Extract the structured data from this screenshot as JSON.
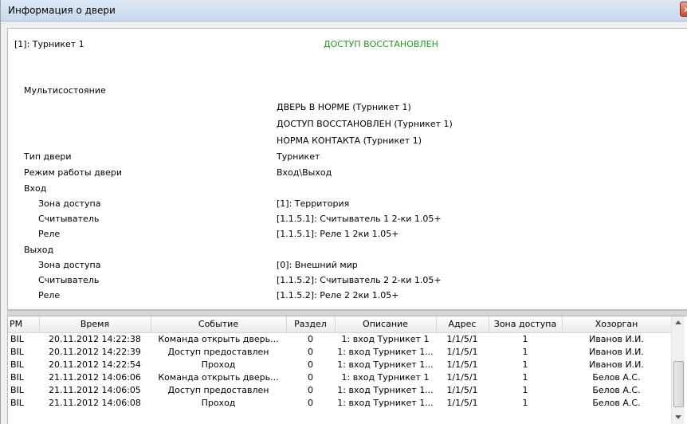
{
  "window": {
    "title": "Информация о двери",
    "close_glyph": "x"
  },
  "door": {
    "name": "[1]: Турникет 1",
    "status": "ДОСТУП ВОССТАНОВЛЕН",
    "status_color": "#1f9a1f"
  },
  "properties": {
    "multistate_label": "Мультисостояние",
    "multistate_values": [
      "ДВЕРЬ В НОРМЕ (Турникет 1)",
      "ДОСТУП ВОССТАНОВЛЕН (Турникет 1)",
      "НОРМА КОНТАКТА (Турникет 1)"
    ],
    "door_type_label": "Тип двери",
    "door_type_value": "Турникет",
    "mode_label": "Режим работы двери",
    "mode_value": "Вход\\Выход",
    "entry_label": "Вход",
    "entry_zone_label": "Зона доступа",
    "entry_zone_value": "[1]: Территория",
    "entry_reader_label": "Считыватель",
    "entry_reader_value": "[1.1.5.1]: Считыватель 1 2-ки 1.05+",
    "entry_relay_label": "Реле",
    "entry_relay_value": "[1.1.5.1]: Реле 1 2ки 1.05+",
    "exit_label": "Выход",
    "exit_zone_label": "Зона доступа",
    "exit_zone_value": "[0]: Внешний мир",
    "exit_reader_label": "Считыватель",
    "exit_reader_value": "[1.1.5.2]: Считыватель 2 2-ки 1.05+",
    "exit_relay_label": "Реле",
    "exit_relay_value": "[1.1.5.2]: Реле 2 2ки 1.05+"
  },
  "events": {
    "columns": [
      "РМ",
      "Время",
      "Событие",
      "Раздел",
      "Описание",
      "Адрес",
      "Зона доступа",
      "Хозорган"
    ],
    "rows": [
      [
        "BIL",
        "20.11.2012 14:22:38",
        "Команда открыть дверь...",
        "0",
        "1: вход  Турникет 1",
        "1/1/5/1",
        "1",
        "Иванов И.И."
      ],
      [
        "BIL",
        "20.11.2012 14:22:39",
        "Доступ предоставлен",
        "0",
        "1: вход  Турникет 1...",
        "1/1/5/1",
        "1",
        "Иванов И.И."
      ],
      [
        "BIL",
        "20.11.2012 14:22:54",
        "Проход",
        "0",
        "1: вход  Турникет 1...",
        "1/1/5/1",
        "1",
        "Иванов И.И."
      ],
      [
        "BIL",
        "21.11.2012 14:06:06",
        "Команда открыть дверь...",
        "0",
        "1: вход  Турникет 1",
        "1/1/5/1",
        "1",
        "Белов А.С."
      ],
      [
        "BIL",
        "21.11.2012 14:06:05",
        "Доступ предоставлен",
        "0",
        "1: вход  Турникет 1...",
        "1/1/5/1",
        "1",
        "Белов А.С."
      ],
      [
        "BIL",
        "21.11.2012 14:06:08",
        "Проход",
        "0",
        "1: вход  Турникет 1...",
        "1/1/5/1",
        "1",
        "Белов А.С."
      ]
    ]
  }
}
